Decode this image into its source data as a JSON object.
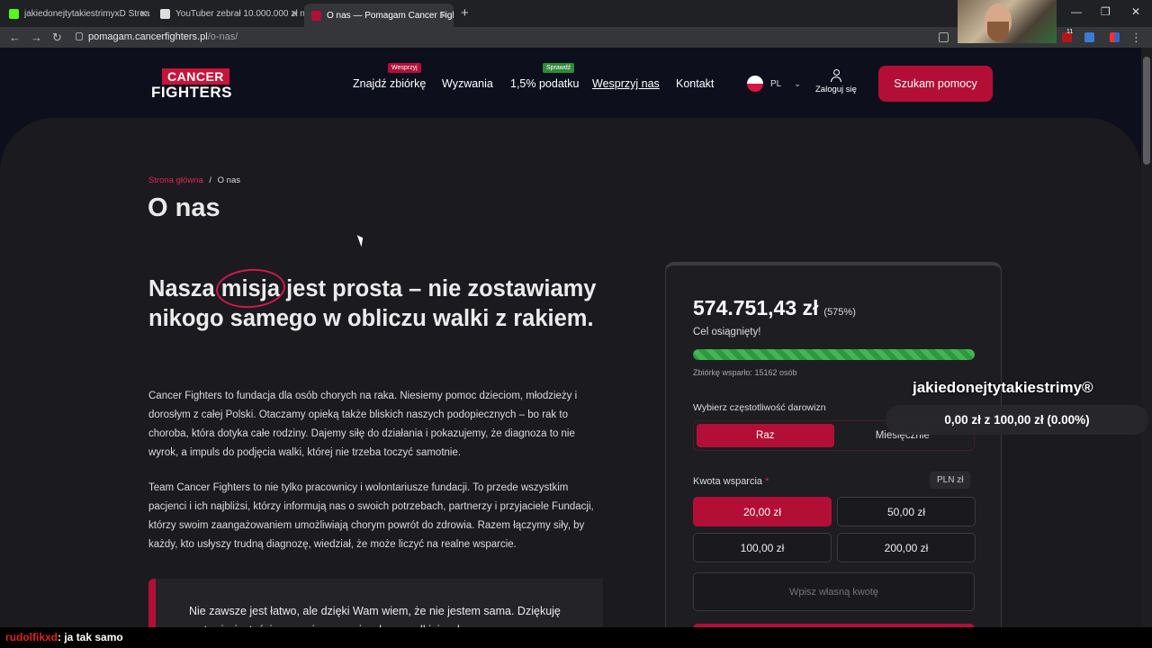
{
  "browser": {
    "tabs": [
      {
        "title": "jakiedonejtytakiestrimyxD Strea",
        "fav_color": "#53fc18"
      },
      {
        "title": "YouTuber zebrał 10.000.000 zł n",
        "fav_color": "#dddddd"
      },
      {
        "title": "O nas — Pomagam Cancer Figh",
        "fav_color": "#b30f36"
      }
    ],
    "close_glyph": "✕",
    "new_tab_glyph": "+",
    "url_host": "pomagam.cancerfighters.pl",
    "url_path": "/o-nas/",
    "extension_badge": "11"
  },
  "site": {
    "logo_top": "CANCER",
    "logo_bottom": "FIGHTERS",
    "nav": [
      {
        "label": "Znajdź zbiórkę",
        "badge": "Wesprzyj",
        "badge_color": "#b30f36"
      },
      {
        "label": "Wyzwania"
      },
      {
        "label": "1,5% podatku",
        "badge": "Sprawdź",
        "badge_color": "#2e8b3a"
      },
      {
        "label": "Wesprzyj nas"
      },
      {
        "label": "Kontakt"
      }
    ],
    "language": "PL",
    "login_label": "Zaloguj się",
    "help_button": "Szukam pomocy"
  },
  "page": {
    "breadcrumb_home": "Strona główna",
    "breadcrumb_sep": "/",
    "breadcrumb_current": "O nas",
    "title": "O nas",
    "mission_before": "Nasza ",
    "mission_highlight": "misja",
    "mission_after": " jest prosta – nie zostawiamy nikogo samego w obliczu walki z rakiem.",
    "para1": "Cancer Fighters to fundacja dla osób chorych na raka. Niesiemy pomoc dzieciom, młodzieży i dorosłym z całej Polski. Otaczamy opieką także bliskich naszych podopiecznych – bo rak to choroba, która dotyka całe rodziny. Dajemy siłę do działania i pokazujemy, że diagnoza to nie wyrok, a impuls do podjęcia walki, której nie trzeba toczyć samotnie.",
    "para2": "Team Cancer Fighters to nie tylko pracownicy i wolontariusze fundacji. To przede wszystkim pacjenci i ich najbliżsi, którzy informują nas o swoich potrzebach, partnerzy i przyjaciele Fundacji, którzy swoim zaangażowaniem umożliwiają chorym powrót do zdrowia. Razem łączymy siły, by każdy, kto usłyszy trudną diagnozę, wiedział, że może liczyć na realne wsparcie.",
    "quote": "Nie zawsze jest łatwo, ale dzięki Wam wiem, że nie jestem sama. Dziękuję za to, że jesteście z nami w naszej walce – walkiej walce."
  },
  "donation": {
    "amount": "574.751,43 zł",
    "percent": "(575%)",
    "goal_text": "Cel osiągnięty!",
    "progress_fraction": 1.0,
    "supporters": "Zbiórkę wsparło: 15162 osób",
    "frequency_label": "Wybierz częstotliwość darowizn",
    "frequency_options": [
      "Raz",
      "Miesięcznie"
    ],
    "amount_label": "Kwota wsparcia",
    "required_mark": "*",
    "currency": "PLN  zł",
    "amounts": [
      "20,00 zł",
      "50,00 zł",
      "100,00 zł",
      "200,00 zł"
    ],
    "custom_placeholder": "Wpisz własną kwotę"
  },
  "stream_overlay": {
    "channel": "jakiedonejtytakiestrimy®",
    "goal": "0,00 zł z 100,00 zł (0.00%)",
    "chat_user": "rudolfikxd",
    "chat_message": ": ja tak samo"
  }
}
